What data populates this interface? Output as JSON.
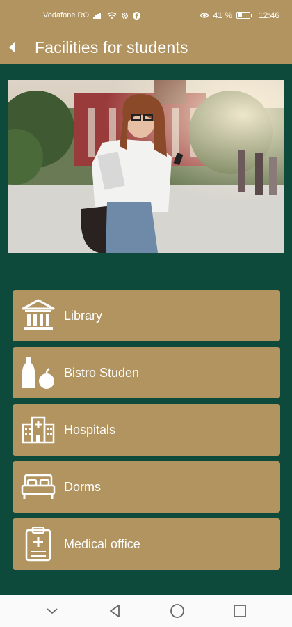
{
  "status_bar": {
    "carrier": "Vodafone RO",
    "battery_text": "41 %",
    "battery_level": 0.41,
    "time": "12:46"
  },
  "header": {
    "title": "Facilities for students"
  },
  "facilities": [
    {
      "label": "Library",
      "icon": "library-icon"
    },
    {
      "label": "Bistro Studen",
      "icon": "bistro-icon"
    },
    {
      "label": "Hospitals",
      "icon": "hospital-icon"
    },
    {
      "label": "Dorms",
      "icon": "dorm-bed-icon"
    },
    {
      "label": "Medical office",
      "icon": "medical-clipboard-icon"
    }
  ],
  "colors": {
    "accent": "#b19460",
    "background": "#0e4a3b",
    "text": "#ffffff"
  }
}
